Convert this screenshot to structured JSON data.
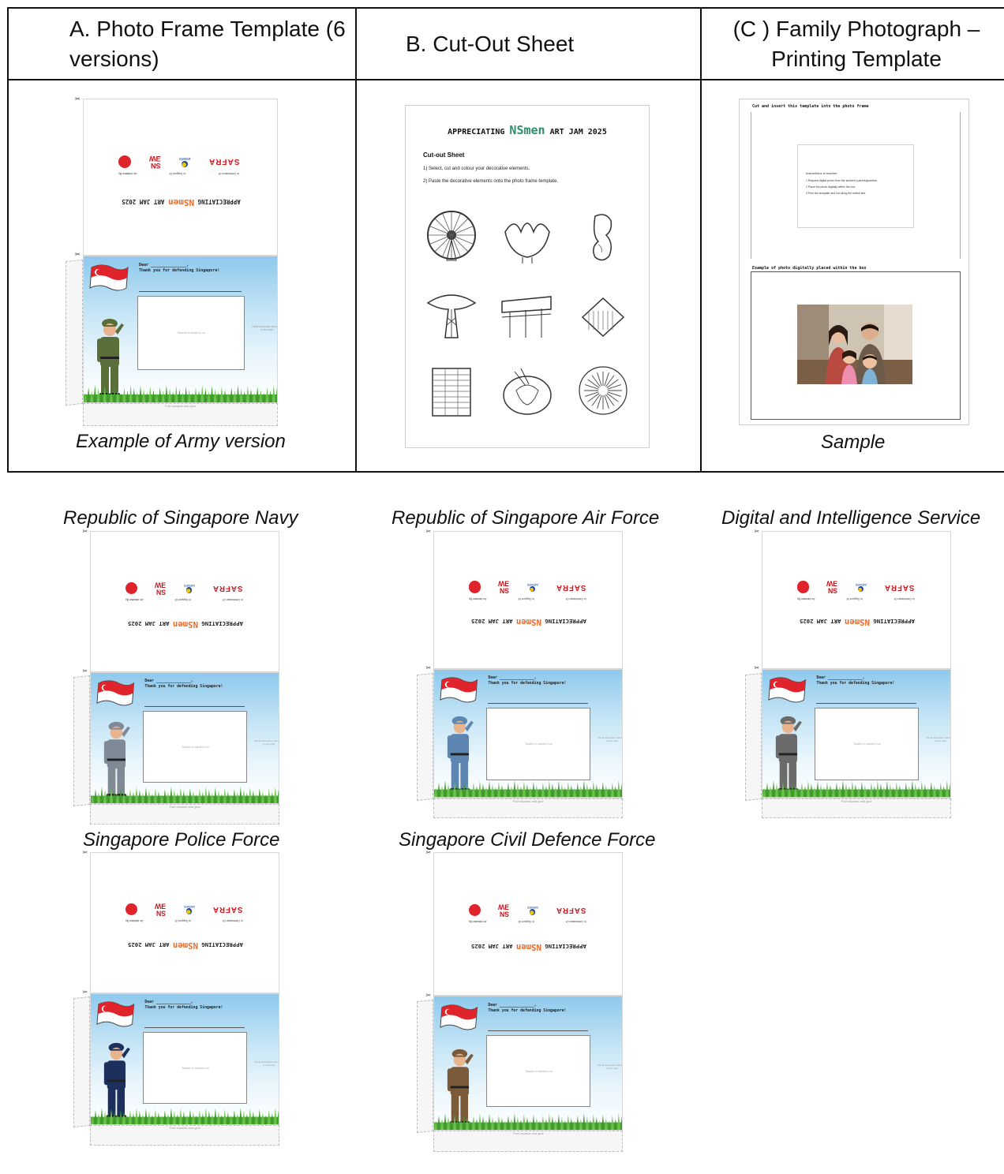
{
  "table": {
    "headers": {
      "a": "A.  Photo Frame Template (6 versions)",
      "b": "B.   Cut-Out Sheet",
      "c": "(C ) Family Photograph – Printing Template"
    },
    "captions": {
      "a": "Example of Army version",
      "c": "Sample"
    }
  },
  "template_text": {
    "title_pre": "APPRECIATING ",
    "title_ns": "NSmen",
    "title_post": " ART JAM 2025",
    "logo_60": "60",
    "logo_ns": "SN\nƎW",
    "logo_assets": "assets",
    "logo_safra": "SAFRA",
    "logo_labels": [
      "In Celebration Of",
      "In Support Of",
      "An Initiative By"
    ],
    "dear": "Dear _______________,",
    "thanks": "Thank you for defending Singapore!",
    "teacher_note": "Teacher to assist to cut",
    "paste_note": "Paste decorative elements on the side",
    "fold_note": "Fold inwards and glue"
  },
  "cutout_sheet": {
    "title_pre": "APPRECIATING ",
    "title_ns": "NSmen",
    "title_post": " ART JAM 2025",
    "subtitle": "Cut-out Sheet",
    "steps": [
      "1) Select, cut and colour your decorative elements.",
      "2) Paste the decorative elements onto the photo frame template."
    ],
    "items": [
      "ferris-wheel",
      "art-science-museum",
      "merlion",
      "supertree",
      "mrt-train",
      "jewel-building",
      "hdb-flats",
      "chilli-crab-dish",
      "fireworks"
    ]
  },
  "family_template": {
    "instruction": "Cut and insert this template into the photo frame",
    "inner_heading": "Instructions to teacher:",
    "inner_steps": [
      "1  Request digital photo from the student's parent/guardian.",
      "2  Place the photo digitally within the box.",
      "3  Print the template and cut along the dotted line."
    ],
    "example_label": "Example of photo digitally placed within the box"
  },
  "versions": [
    {
      "label": "Republic of Singapore Navy",
      "uniform": "#7f8a96"
    },
    {
      "label": "Republic of Singapore Air Force",
      "uniform": "#5d86b3"
    },
    {
      "label": "Digital and Intelligence Service",
      "uniform": "#6b6b6b"
    },
    {
      "label": "Singapore Police Force",
      "uniform": "#1d2f5c"
    },
    {
      "label": "Singapore Civil Defence Force",
      "uniform": "#7b5a3a"
    }
  ],
  "army_uniform": "#5a6e3a"
}
